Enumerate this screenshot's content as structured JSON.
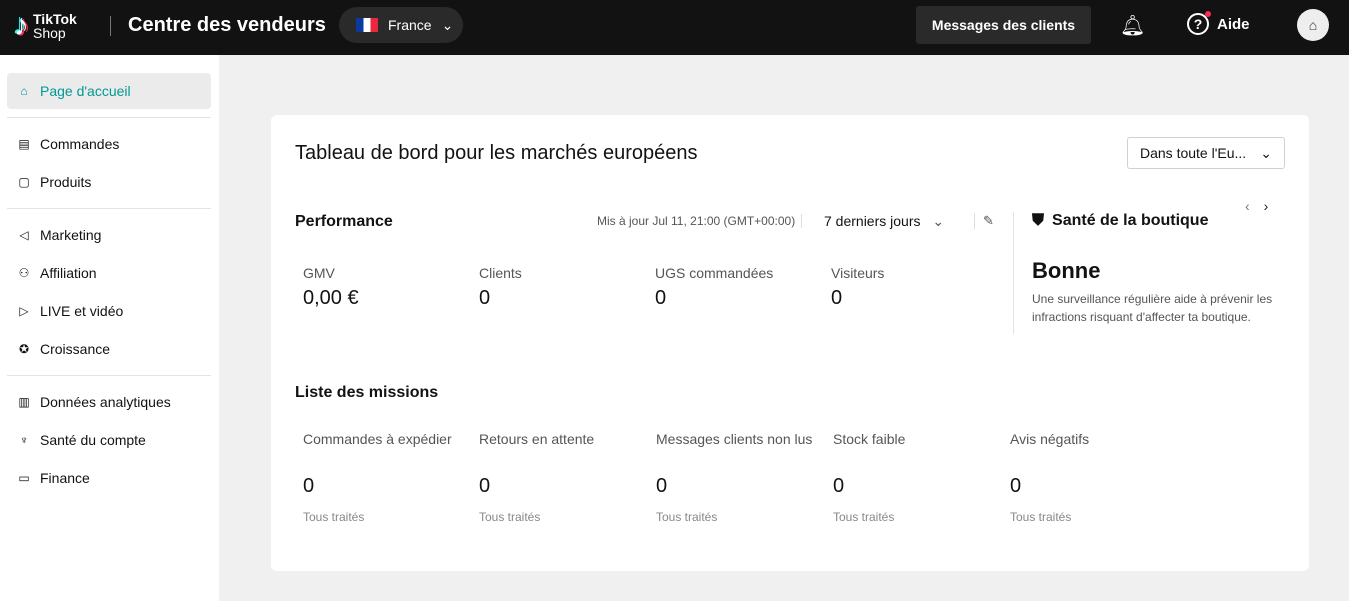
{
  "header": {
    "logo_line1": "TikTok",
    "logo_line2": "Shop",
    "title": "Centre des vendeurs",
    "country": "France",
    "messages": "Messages des clients",
    "help": "Aide",
    "accent": "#009995"
  },
  "sidebar": {
    "items": [
      {
        "label": "Page d'accueil"
      },
      {
        "label": "Commandes"
      },
      {
        "label": "Produits"
      },
      {
        "label": "Marketing"
      },
      {
        "label": "Affiliation"
      },
      {
        "label": "LIVE et vidéo"
      },
      {
        "label": "Croissance"
      },
      {
        "label": "Données analytiques"
      },
      {
        "label": "Santé du compte"
      },
      {
        "label": "Finance"
      }
    ]
  },
  "dashboard": {
    "title": "Tableau de bord pour les marchés européens",
    "region": "Dans toute l'Eu...",
    "performance": {
      "title": "Performance",
      "updated": "Mis à jour Jul 11, 21:00 (GMT+00:00)",
      "range": "7 derniers jours",
      "metrics": [
        {
          "label": "GMV",
          "value": "0,00 €"
        },
        {
          "label": "Clients",
          "value": "0"
        },
        {
          "label": "UGS commandées",
          "value": "0"
        },
        {
          "label": "Visiteurs",
          "value": "0"
        }
      ]
    },
    "health": {
      "title": "Santé de la boutique",
      "status": "Bonne",
      "description": "Une surveillance régulière aide à prévenir les infractions risquant d'affecter ta boutique."
    },
    "missions": {
      "title": "Liste des missions",
      "items": [
        {
          "label": "Commandes à expédier",
          "value": "0",
          "status": "Tous traités"
        },
        {
          "label": "Retours en attente",
          "value": "0",
          "status": "Tous traités"
        },
        {
          "label": "Messages clients non lus",
          "value": "0",
          "status": "Tous traités"
        },
        {
          "label": "Stock faible",
          "value": "0",
          "status": "Tous traités"
        },
        {
          "label": "Avis négatifs",
          "value": "0",
          "status": "Tous traités"
        }
      ]
    }
  }
}
